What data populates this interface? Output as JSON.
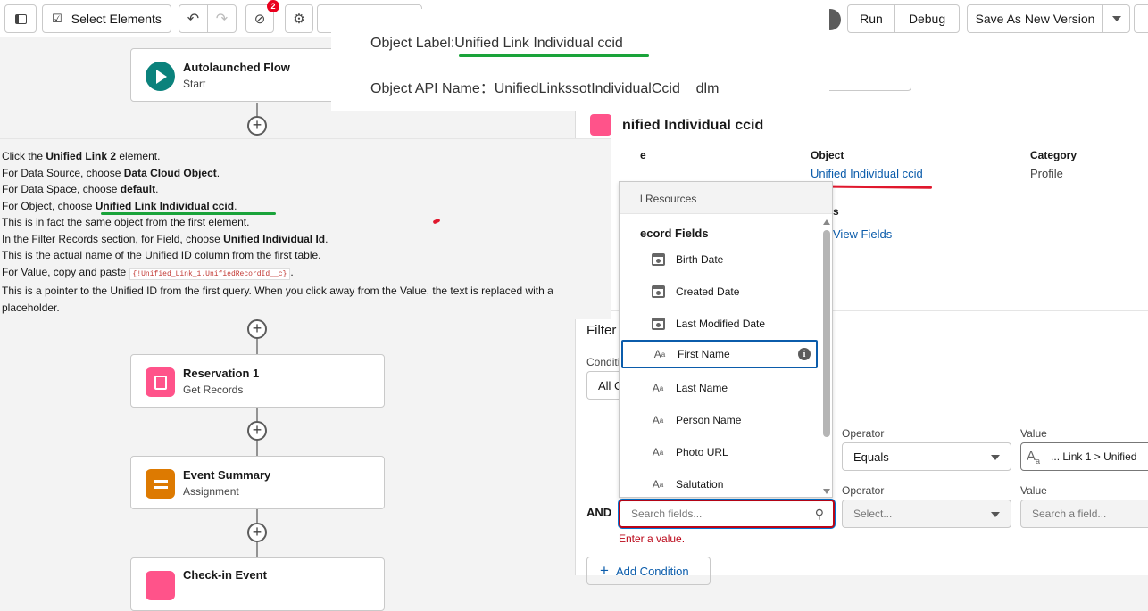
{
  "toolbar": {
    "select_elements": "Select Elements",
    "error_count": "2",
    "run": "Run",
    "debug": "Debug",
    "save_as_new_version": "Save As New Version"
  },
  "canvas": {
    "nodes": [
      {
        "title": "Autolaunched Flow",
        "subtitle": "Start"
      },
      {
        "title": "Reservation 1",
        "subtitle": "Get Records"
      },
      {
        "title": "Event Summary",
        "subtitle": "Assignment"
      },
      {
        "title": "Check-in Event",
        "subtitle": ""
      }
    ]
  },
  "object_box": {
    "label_prefix": "Object Label:",
    "label_value": "Unified Link Individual ccid",
    "api_prefix": "Object API Name：",
    "api_value": "UnifiedLinkssotIndividualCcid__dlm"
  },
  "instructions": {
    "l1a": "Click the ",
    "l1b": "Unified Link 2",
    "l1c": " element.",
    "l2a": "For Data Source, choose ",
    "l2b": "Data Cloud Object",
    "l2c": ".",
    "l3a": "For Data Space, choose ",
    "l3b": "default",
    "l3c": ".",
    "l4a": "For Object, choose ",
    "l4b": "Unified Link Individual ccid",
    "l4c": ".",
    "l5": "This is in fact the same object from the first element.",
    "l6a": "In the Filter Records section, for Field, choose ",
    "l6b": "Unified Individual Id",
    "l6c": ".",
    "l7": "This is the actual name of the Unified ID column from the first table.",
    "l8a": "For Value, copy and paste ",
    "l8b": "{!Unified_Link_1.UnifiedRecordId__c}",
    "l8c": ".",
    "l9": "This is a pointer to the Unified ID from the first query. When you click away from the Value, the text is replaced with a",
    "l10": "placeholder."
  },
  "panel": {
    "heading": "nified Individual ccid",
    "col1_label": "e",
    "object_label": "Object",
    "object_value": "Unified Individual ccid",
    "category_label": "Category",
    "category_value": "Profile",
    "s_frag": "s",
    "view_fields": "View Fields",
    "filter_frag": "Filter",
    "condi_frag": "Conditi",
    "allc_frag": "All C",
    "operator_label": "Operator",
    "value_label": "Value",
    "operator_value": "Equals",
    "value_text": "... Link 1 > Unified",
    "operator2_placeholder": "Select...",
    "value2_placeholder": "Search a field...",
    "and_label": "AND",
    "search_placeholder": "Search fields...",
    "error_text": "Enter a value.",
    "add_condition": "Add Condition"
  },
  "dropdown": {
    "header": "l Resources",
    "section": "ecord Fields",
    "items": [
      {
        "label": "Birth Date",
        "icon": "calendar-icon"
      },
      {
        "label": "Created Date",
        "icon": "calendar-icon"
      },
      {
        "label": "Last Modified Date",
        "icon": "calendar-icon"
      },
      {
        "label": "First Name",
        "icon": "text-icon"
      },
      {
        "label": "Last Name",
        "icon": "text-icon"
      },
      {
        "label": "Person Name",
        "icon": "text-icon"
      },
      {
        "label": "Photo URL",
        "icon": "text-icon"
      },
      {
        "label": "Salutation",
        "icon": "text-icon"
      }
    ]
  },
  "colors": {
    "green_underline": "#1aa33a",
    "red_underline": "#e0182d",
    "brand_blue": "#0176d3",
    "start_teal": "#0b827c",
    "pink": "#ff538a",
    "orange": "#dd7a01"
  }
}
